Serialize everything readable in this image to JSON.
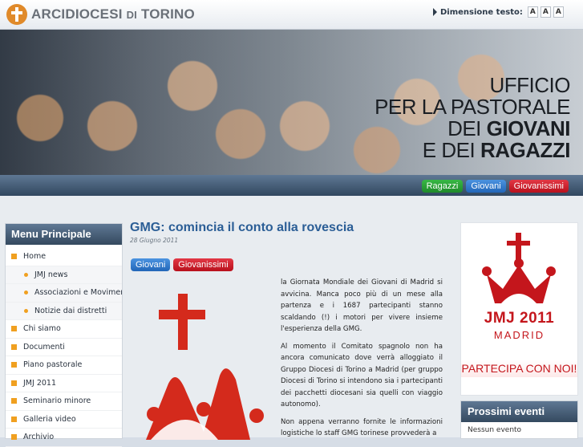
{
  "header": {
    "logo_word1": "ARCIDIOCESI",
    "logo_word2": "DI",
    "logo_word3": "TORINO",
    "font_size_label": "Dimensione testo:",
    "font_size_buttons": [
      "A",
      "A",
      "A"
    ]
  },
  "banner": {
    "line1": "UFFICIO",
    "line2": "PER LA PASTORALE",
    "line3_a": "DEI",
    "line3_b": "GIOVANI",
    "line4_a": "E DEI",
    "line4_b": "RAGAZZI"
  },
  "nav_tabs": [
    {
      "label": "Ragazzi",
      "color": "#28a035"
    },
    {
      "label": "Giovani",
      "color": "#2f7bd0"
    },
    {
      "label": "Giovanissimi",
      "color": "#cc1a26"
    }
  ],
  "sidebar": {
    "title": "Menu Principale",
    "items": [
      {
        "label": "Home"
      },
      {
        "label": "JMJ news"
      },
      {
        "label": "Associazioni e Movimenti"
      },
      {
        "label": "Notizie dai distretti"
      },
      {
        "label": "Chi siamo"
      },
      {
        "label": "Documenti"
      },
      {
        "label": "Piano pastorale"
      },
      {
        "label": "JMJ 2011"
      },
      {
        "label": "Seminario minore"
      },
      {
        "label": "Galleria video"
      },
      {
        "label": "Archivio"
      }
    ]
  },
  "post": {
    "title": "GMG: comincia il conto alla rovescia",
    "date": "28 Giugno 2011",
    "tags": [
      "Giovani",
      "Giovanissimi"
    ],
    "paragraphs": [
      "la Giornata Mondiale dei Giovani di Madrid si avvicina. Manca poco più di un mese alla partenza e i 1687 partecipanti stanno scaldando (!) i motori per vivere insieme l'esperienza della GMG.",
      "Al momento il Comitato spagnolo non ha ancora comunicato dove verrà alloggiato il Gruppo Diocesi di Torino a Madrid (per gruppo Diocesi di Torino si intendono sia i partecipanti dei pacchetti diocesani sia quelli con viaggio autonomo).",
      "Non appena verranno fornite le informazioni logistiche lo staff GMG torinese provvederà a"
    ]
  },
  "jmj_banner": {
    "line1": "JMJ 2011",
    "line2": "MADRID",
    "cta": "PARTECIPA CON NOI!"
  },
  "events": {
    "title": "Prossimi eventi",
    "empty": "Nessun evento"
  },
  "colors": {
    "brand_blue": "#2b5e96",
    "menu_bullet": "#f0a020",
    "jmj_red": "#c4161c"
  }
}
